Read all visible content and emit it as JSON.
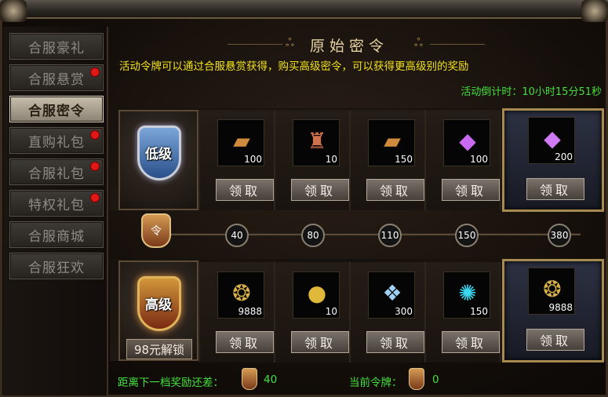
{
  "sidebar": {
    "items": [
      {
        "label": "合服豪礼",
        "badge": false,
        "active": false
      },
      {
        "label": "合服悬赏",
        "badge": true,
        "active": false
      },
      {
        "label": "合服密令",
        "badge": false,
        "active": true
      },
      {
        "label": "直购礼包",
        "badge": true,
        "active": false
      },
      {
        "label": "合服礼包",
        "badge": true,
        "active": false
      },
      {
        "label": "特权礼包",
        "badge": true,
        "active": false
      },
      {
        "label": "合服商城",
        "badge": false,
        "active": false
      },
      {
        "label": "合服狂欢",
        "badge": false,
        "active": false
      }
    ]
  },
  "header": {
    "title": "原始密令",
    "description": "活动令牌可以通过合服悬赏获得，购买高级密令，可以获得更高级别的奖励",
    "countdown": "活动倒计时：10小时15分51秒"
  },
  "low_tier": {
    "label": "低级",
    "claim_label": "领取",
    "items": [
      {
        "icon": "scroll-icon",
        "qty": "100"
      },
      {
        "icon": "scroll-bundle-icon",
        "qty": "10"
      },
      {
        "icon": "scroll-icon",
        "qty": "150"
      },
      {
        "icon": "purple-crystal-icon",
        "qty": "100"
      },
      {
        "icon": "purple-crystal-icon",
        "qty": "200"
      }
    ]
  },
  "high_tier": {
    "label": "高级",
    "unlock_label": "98元解锁",
    "claim_label": "领取",
    "items": [
      {
        "icon": "gold-coin-icon",
        "qty": "9888"
      },
      {
        "icon": "gold-orb-icon",
        "qty": "10"
      },
      {
        "icon": "blue-crystal-icon",
        "qty": "300"
      },
      {
        "icon": "blue-gem-icon",
        "qty": "150"
      },
      {
        "icon": "gold-coin-icon",
        "qty": "9888"
      }
    ]
  },
  "progress": {
    "milestones": [
      "40",
      "80",
      "110",
      "150",
      "380"
    ]
  },
  "footer": {
    "next_tier_label": "距离下一档奖励还差：",
    "next_tier_value": "40",
    "current_tokens_label": "当前令牌：",
    "current_tokens_value": "0"
  },
  "colors": {
    "accent_yellow": "#f0e21a",
    "accent_green": "#43e03c",
    "badge_red": "#e01818"
  }
}
